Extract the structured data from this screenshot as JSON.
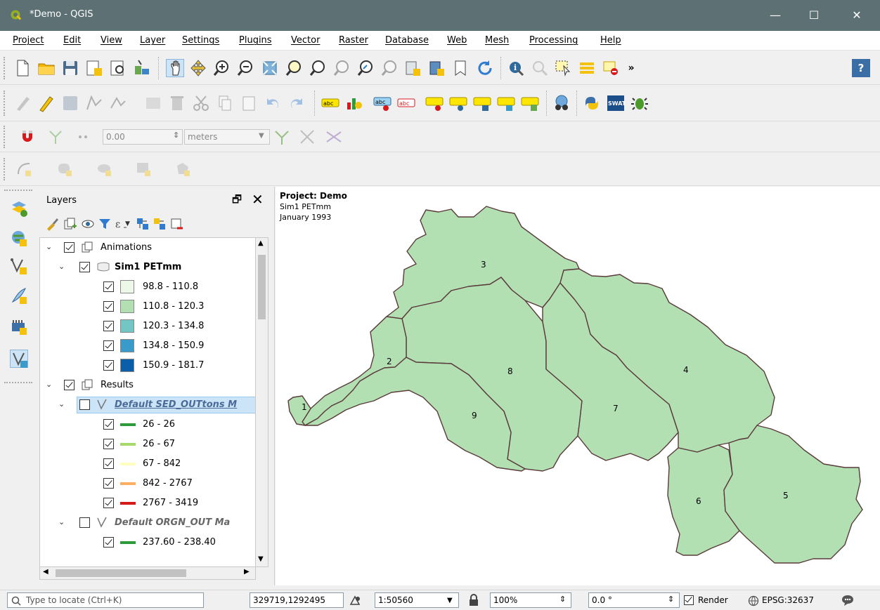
{
  "window": {
    "title": "*Demo - QGIS",
    "minimize": "—",
    "maximize": "☐",
    "close": "✕"
  },
  "menu": [
    "Project",
    "Edit",
    "View",
    "Layer",
    "Settings",
    "Plugins",
    "Vector",
    "Raster",
    "Database",
    "Web",
    "Mesh",
    "Processing",
    "Help"
  ],
  "toolbar": {
    "more": "»",
    "help": "?",
    "snap_tolerance": "0.00",
    "snap_units": "meters",
    "spin_arrows": "⇕"
  },
  "layers_panel": {
    "title": "Layers",
    "float_icon": "🗗",
    "close_icon": "✕",
    "tree": [
      {
        "type": "group",
        "label": "Animations",
        "expanded": true,
        "checked": true,
        "level": 0
      },
      {
        "type": "layer",
        "label": "Sim1 PETmm",
        "bold": true,
        "expanded": true,
        "checked": true,
        "level": 1
      },
      {
        "type": "class",
        "label": "98.8 - 110.8",
        "color": "#edf8e9",
        "checked": true
      },
      {
        "type": "class",
        "label": "110.8 - 120.3",
        "color": "#b3e0b3",
        "checked": true
      },
      {
        "type": "class",
        "label": "120.3 - 134.8",
        "color": "#74c6c4",
        "checked": true
      },
      {
        "type": "class",
        "label": "134.8 - 150.9",
        "color": "#3a9ac9",
        "checked": true
      },
      {
        "type": "class",
        "label": "150.9 - 181.7",
        "color": "#0b5ea8",
        "checked": true
      },
      {
        "type": "group",
        "label": "Results",
        "expanded": true,
        "checked": true,
        "level": 0
      },
      {
        "type": "layer",
        "label": "Default SED_OUTtons M",
        "italic": true,
        "selected": true,
        "expanded": true,
        "checked": false,
        "level": 1
      },
      {
        "type": "lineclass",
        "label": "26 - 26",
        "color": "#2e9b3a",
        "checked": true
      },
      {
        "type": "lineclass",
        "label": "26 - 67",
        "color": "#a6d96a",
        "checked": true
      },
      {
        "type": "lineclass",
        "label": "67 - 842",
        "color": "#ffffbf",
        "checked": true
      },
      {
        "type": "lineclass",
        "label": "842 - 2767",
        "color": "#fdae61",
        "checked": true
      },
      {
        "type": "lineclass",
        "label": "2767 - 3419",
        "color": "#d7191c",
        "checked": true
      },
      {
        "type": "layer",
        "label": "Default ORGN_OUT Ma",
        "italic": true,
        "expanded": true,
        "checked": false,
        "level": 1
      },
      {
        "type": "lineclass",
        "label": "237.60 - 238.40",
        "color": "#2e9b3a",
        "checked": true
      }
    ]
  },
  "map": {
    "title": "Project: Demo",
    "line1": "Sim1 PETmm",
    "line2": "January 1993",
    "fill_color": "#b3e0b3",
    "stroke_color": "#5a3a3a",
    "subbasin_labels": [
      "1",
      "2",
      "3",
      "4",
      "5",
      "6",
      "7",
      "8",
      "9"
    ]
  },
  "statusbar": {
    "locate_placeholder": "Type to locate (Ctrl+K)",
    "coord_label": "",
    "coordinate": "329719,1292495",
    "scale_label": "",
    "scale": "1:50560",
    "magnifier_label": "",
    "magnifier": "100%",
    "rotation_label": "",
    "rotation": "0.0 °",
    "render_label": "Render",
    "render_checked": true,
    "crs": "EPSG:32637"
  }
}
